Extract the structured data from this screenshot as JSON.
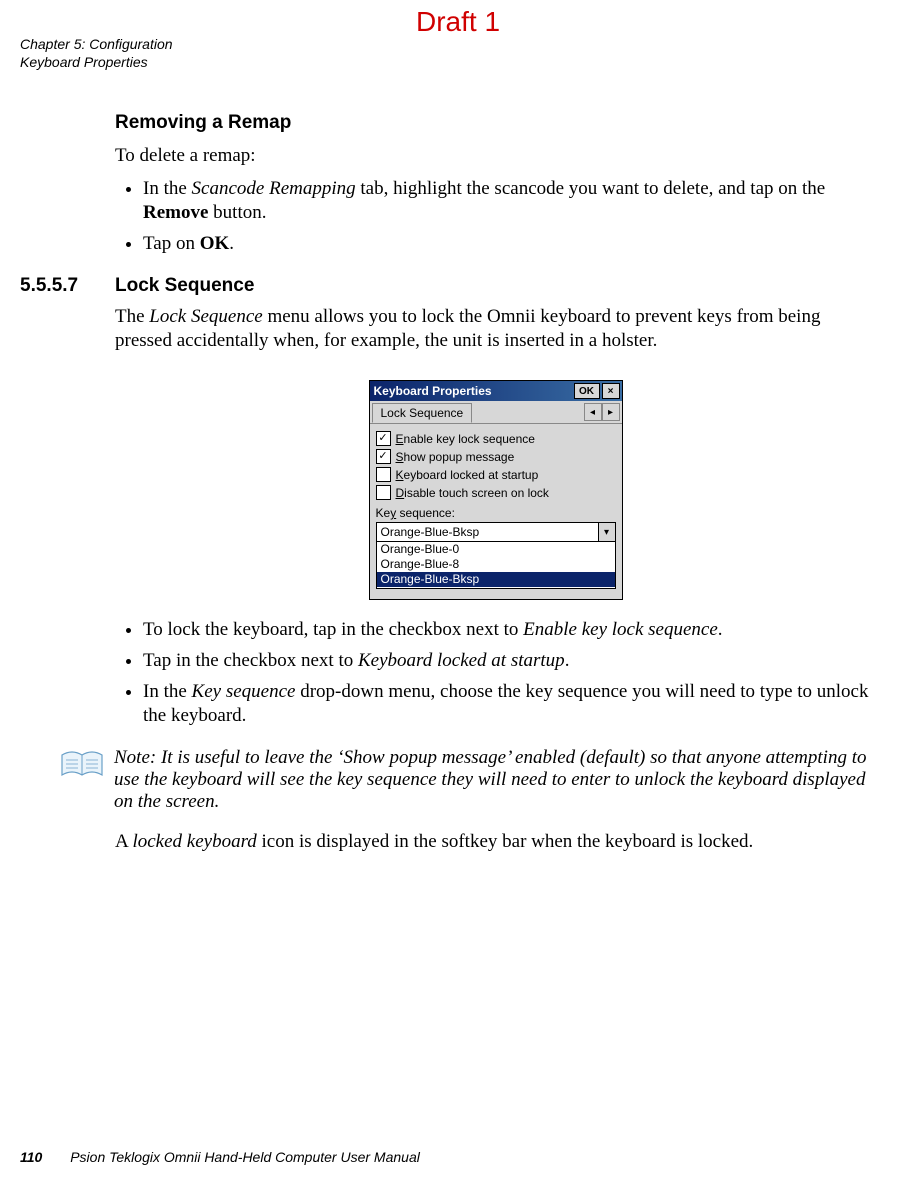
{
  "draft_label": "Draft 1",
  "header": {
    "chapter_line": "Chapter 5: Configuration",
    "section_line": "Keyboard Properties"
  },
  "sec_a": {
    "title": "Removing a Remap",
    "intro": "To delete a remap:",
    "bullets": {
      "b1_pre": "In the ",
      "b1_em": "Scancode Remapping",
      "b1_mid": " tab, highlight the scancode you want to delete, and tap on the ",
      "b1_bold": "Remove",
      "b1_post": " button.",
      "b2_pre": "Tap on ",
      "b2_bold": "OK",
      "b2_post": "."
    }
  },
  "sec_b": {
    "number": "5.5.5.7",
    "title": "Lock Sequence",
    "para_pre": "The ",
    "para_em": "Lock Sequence",
    "para_post": " menu allows you to lock the Omnii keyboard to prevent keys from being pressed accidentally when, for example, the unit is inserted in a holster."
  },
  "screenshot": {
    "title": "Keyboard Properties",
    "ok_label": "OK",
    "close_glyph": "×",
    "tab_label": "Lock Sequence",
    "nav_left": "◂",
    "nav_right": "▸",
    "checkboxes": [
      {
        "checked": true,
        "u": "E",
        "rest": "nable key lock sequence"
      },
      {
        "checked": true,
        "u": "S",
        "rest": "how popup message"
      },
      {
        "checked": false,
        "u": "K",
        "rest": "eyboard locked at startup"
      },
      {
        "checked": false,
        "u": "D",
        "rest": "isable touch screen on lock"
      }
    ],
    "key_sequence_label_u": "y",
    "key_sequence_label_pre": "Ke",
    "key_sequence_label_post": " sequence:",
    "combo_value": "Orange-Blue-Bksp",
    "combo_glyph": "▾",
    "options": [
      "Orange-Blue-0",
      "Orange-Blue-8",
      "Orange-Blue-Bksp"
    ],
    "selected_index": 2
  },
  "sec_b_bullets": {
    "b1_pre": "To lock the keyboard, tap in the checkbox next to ",
    "b1_em": "Enable key lock sequence",
    "b1_post": ".",
    "b2_pre": "Tap in the checkbox next to ",
    "b2_em": "Keyboard locked at startup",
    "b2_post": ".",
    "b3_pre": "In the ",
    "b3_em": "Key sequence",
    "b3_post": " drop-down menu, choose the key sequence you will need to type to unlock the keyboard."
  },
  "note": {
    "text": "Note: It is useful to leave the ‘Show popup message’ enabled (default) so that anyone attempting to use the keyboard will see the key sequence they will need to enter to unlock the keyboard displayed on the screen."
  },
  "closing": {
    "pre": "A ",
    "em": "locked keyboard",
    "post": " icon is displayed in the softkey bar when the keyboard is locked."
  },
  "footer": {
    "page_number": "110",
    "manual_title": "Psion Teklogix Omnii Hand-Held Computer User Manual"
  }
}
